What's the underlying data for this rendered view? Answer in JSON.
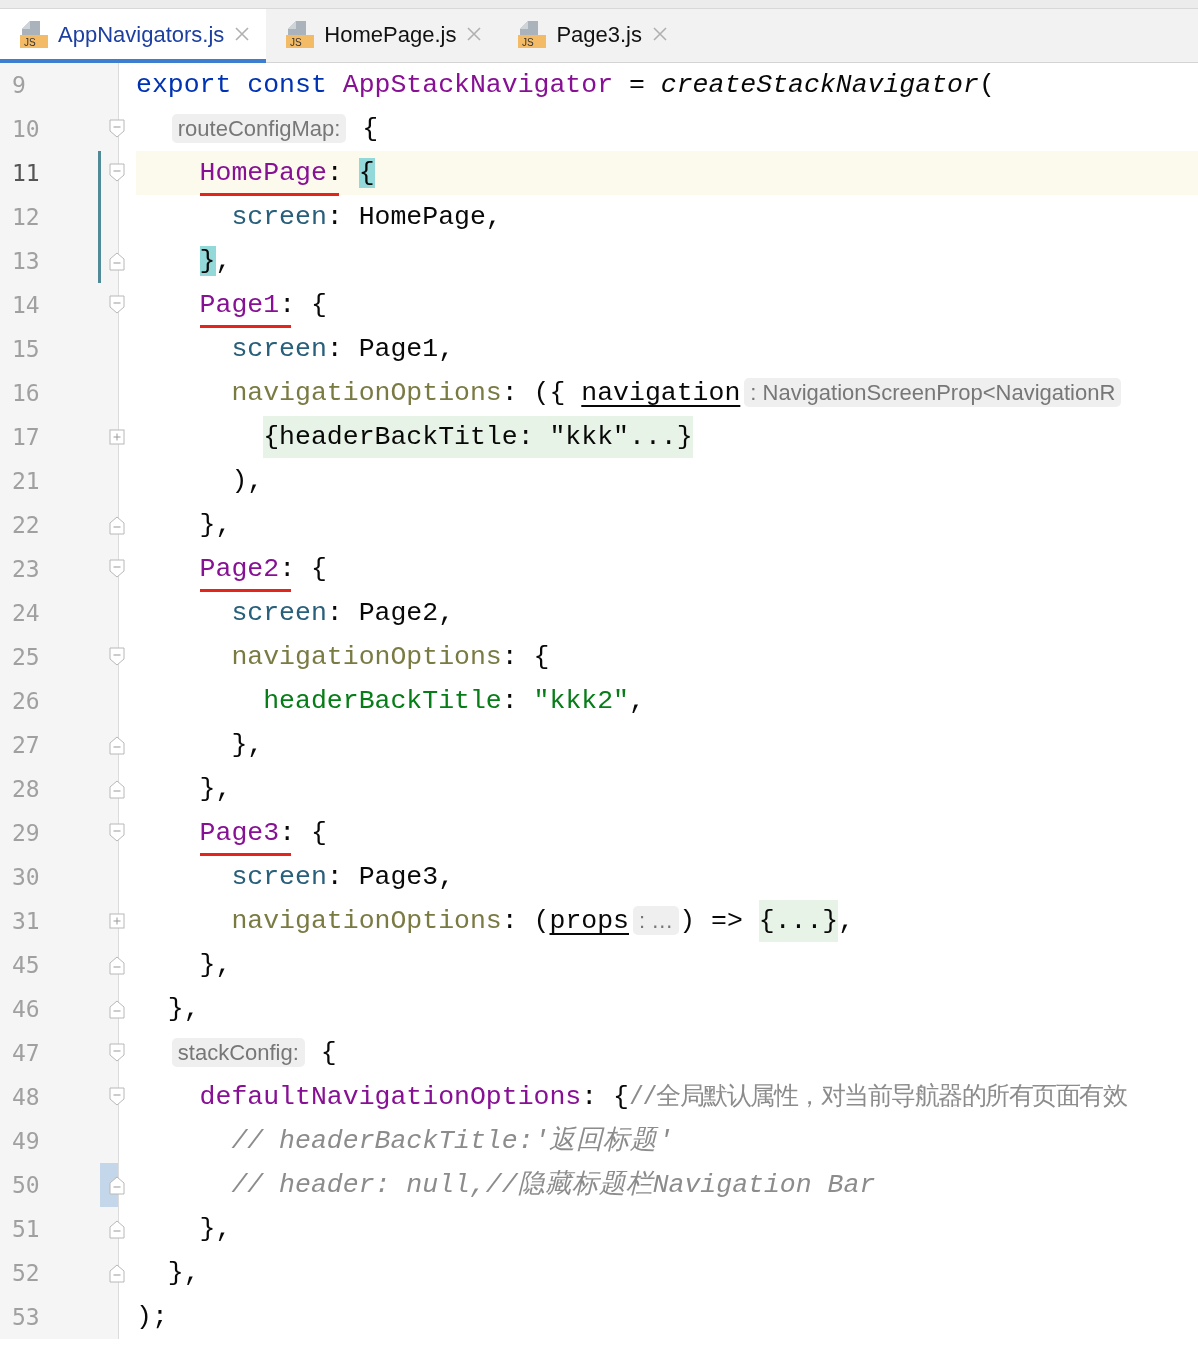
{
  "tabs": [
    {
      "icon_text": "JS",
      "label": "AppNavigators.js",
      "selected": true
    },
    {
      "icon_text": "JS",
      "label": "HomePage.js",
      "selected": false
    },
    {
      "icon_text": "JS",
      "label": "Page3.js",
      "selected": false
    }
  ],
  "editor": {
    "lines": [
      {
        "number": "9",
        "tokens": [
          {
            "kind": "keyword",
            "text": "export const "
          },
          {
            "kind": "decl",
            "text": "AppStackNavigator"
          },
          {
            "kind": "plain",
            "text": " = "
          },
          {
            "kind": "call",
            "text": "createStackNavigator"
          },
          {
            "kind": "plain",
            "text": "("
          }
        ],
        "children": [
          {
            "number": "10",
            "fold_start": true,
            "tokens": [
              {
                "kind": "hint",
                "text": "routeConfigMap:"
              },
              {
                "kind": "plain",
                "text": " {"
              }
            ],
            "children": [
              {
                "number": "11",
                "fold_start": true,
                "current": true,
                "modified": true,
                "tokens": [
                  {
                    "kind": "prop",
                    "text": "HomePage",
                    "marked": true
                  },
                  {
                    "kind": "plain",
                    "text": ": "
                  },
                  {
                    "kind": "brace",
                    "text": "{"
                  }
                ],
                "children": [
                  {
                    "number": "12",
                    "modified": true,
                    "tokens": [
                      {
                        "kind": "field",
                        "text": "screen"
                      },
                      {
                        "kind": "plain",
                        "text": ": HomePage,"
                      }
                    ]
                  }
                ]
              },
              {
                "number": "13",
                "fold_end": true,
                "modified": true,
                "tokens": [
                  {
                    "kind": "brace",
                    "text": "}"
                  },
                  {
                    "kind": "plain",
                    "text": ","
                  }
                ]
              },
              {
                "number": "14",
                "fold_start": true,
                "tokens": [
                  {
                    "kind": "prop",
                    "text": "Page1",
                    "marked": true
                  },
                  {
                    "kind": "plain",
                    "text": ": {"
                  }
                ],
                "children": [
                  {
                    "number": "15",
                    "tokens": [
                      {
                        "kind": "field",
                        "text": "screen"
                      },
                      {
                        "kind": "plain",
                        "text": ": Page1,"
                      }
                    ]
                  },
                  {
                    "number": "16",
                    "tokens": [
                      {
                        "kind": "method",
                        "text": "navigationOptions"
                      },
                      {
                        "kind": "plain",
                        "text": ": ({ "
                      },
                      {
                        "kind": "param",
                        "text": "navigation"
                      },
                      {
                        "kind": "hint",
                        "text": ": NavigationScreenProp<NavigationR"
                      }
                    ],
                    "children": [
                      {
                        "number": "17",
                        "collapsed": true,
                        "tokens": [
                          {
                            "kind": "folded",
                            "text": "{headerBackTitle: \"kkk\"...}"
                          }
                        ]
                      }
                    ]
                  },
                  {
                    "number": "21",
                    "tokens": [
                      {
                        "kind": "plain",
                        "text": "),"
                      }
                    ]
                  }
                ]
              },
              {
                "number": "22",
                "fold_end": true,
                "tokens": [
                  {
                    "kind": "plain",
                    "text": "},"
                  }
                ]
              },
              {
                "number": "23",
                "fold_start": true,
                "tokens": [
                  {
                    "kind": "prop",
                    "text": "Page2",
                    "marked": true
                  },
                  {
                    "kind": "plain",
                    "text": ": {"
                  }
                ],
                "children": [
                  {
                    "number": "24",
                    "tokens": [
                      {
                        "kind": "field",
                        "text": "screen"
                      },
                      {
                        "kind": "plain",
                        "text": ": Page2,"
                      }
                    ]
                  },
                  {
                    "number": "25",
                    "fold_start": true,
                    "tokens": [
                      {
                        "kind": "method",
                        "text": "navigationOptions"
                      },
                      {
                        "kind": "plain",
                        "text": ": {"
                      }
                    ],
                    "children": [
                      {
                        "number": "26",
                        "tokens": [
                          {
                            "kind": "key",
                            "text": "headerBackTitle"
                          },
                          {
                            "kind": "plain",
                            "text": ": "
                          },
                          {
                            "kind": "string",
                            "text": "\"kkk2\""
                          },
                          {
                            "kind": "plain",
                            "text": ","
                          }
                        ]
                      }
                    ]
                  },
                  {
                    "number": "27",
                    "fold_end": true,
                    "tokens": [
                      {
                        "kind": "plain",
                        "text": "},"
                      }
                    ]
                  }
                ]
              },
              {
                "number": "28",
                "fold_end": true,
                "tokens": [
                  {
                    "kind": "plain",
                    "text": "},"
                  }
                ]
              },
              {
                "number": "29",
                "fold_start": true,
                "tokens": [
                  {
                    "kind": "prop",
                    "text": "Page3",
                    "marked": true
                  },
                  {
                    "kind": "plain",
                    "text": ": {"
                  }
                ],
                "children": [
                  {
                    "number": "30",
                    "tokens": [
                      {
                        "kind": "field",
                        "text": "screen"
                      },
                      {
                        "kind": "plain",
                        "text": ": Page3,"
                      }
                    ]
                  },
                  {
                    "number": "31",
                    "collapsed": true,
                    "tokens": [
                      {
                        "kind": "method",
                        "text": "navigationOptions"
                      },
                      {
                        "kind": "plain",
                        "text": ": ("
                      },
                      {
                        "kind": "param",
                        "text": "props"
                      },
                      {
                        "kind": "hint",
                        "text": ": …"
                      },
                      {
                        "kind": "plain",
                        "text": ") => "
                      },
                      {
                        "kind": "folded",
                        "text": "{...}"
                      },
                      {
                        "kind": "plain",
                        "text": ","
                      }
                    ]
                  }
                ]
              },
              {
                "number": "45",
                "fold_end": true,
                "tokens": [
                  {
                    "kind": "plain",
                    "text": "},"
                  }
                ]
              }
            ]
          },
          {
            "number": "46",
            "fold_end": true,
            "tokens": [
              {
                "kind": "plain",
                "text": "},"
              }
            ]
          },
          {
            "number": "47",
            "fold_start": true,
            "tokens": [
              {
                "kind": "hint",
                "text": "stackConfig:"
              },
              {
                "kind": "plain",
                "text": " {"
              }
            ],
            "children": [
              {
                "number": "48",
                "fold_start": true,
                "tokens": [
                  {
                    "kind": "prop",
                    "text": "defaultNavigationOptions"
                  },
                  {
                    "kind": "plain",
                    "text": ": {"
                  },
                  {
                    "kind": "line_comment",
                    "text": "//全局默认属性，对当前导航器的所有页面有效"
                  }
                ],
                "children": [
                  {
                    "number": "49",
                    "tokens": [
                      {
                        "kind": "comment",
                        "text": "// headerBackTitle:'返回标题'"
                      }
                    ]
                  },
                  {
                    "number": "50",
                    "fold_end": true,
                    "highlighted": true,
                    "tokens": [
                      {
                        "kind": "comment",
                        "text": "// header: null,//隐藏标题栏Navigation Bar"
                      }
                    ]
                  }
                ]
              },
              {
                "number": "51",
                "fold_end": true,
                "tokens": [
                  {
                    "kind": "plain",
                    "text": "},"
                  }
                ]
              }
            ]
          },
          {
            "number": "52",
            "fold_end": true,
            "tokens": [
              {
                "kind": "plain",
                "text": "},"
              }
            ]
          }
        ]
      },
      {
        "number": "53",
        "tokens": [
          {
            "kind": "plain",
            "text": ");"
          }
        ]
      }
    ]
  }
}
